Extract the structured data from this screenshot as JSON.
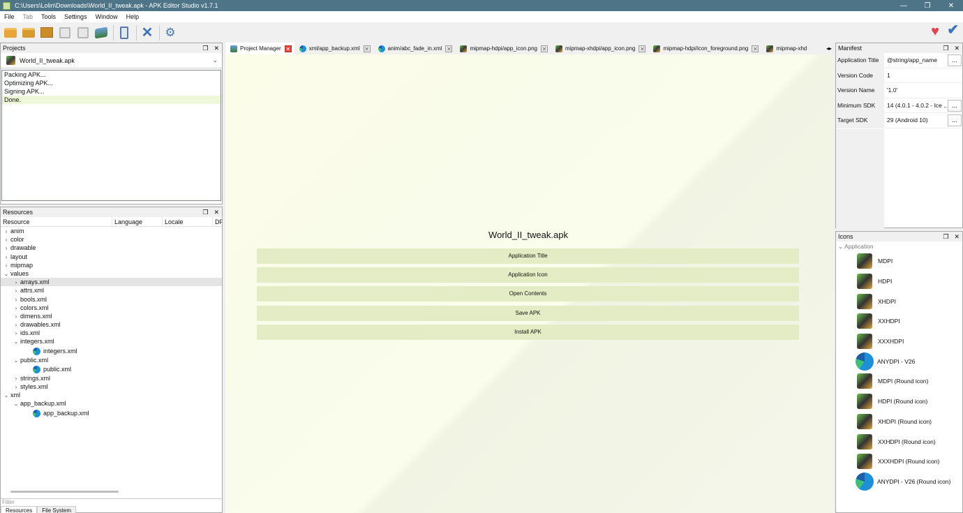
{
  "window": {
    "title": "C:\\Users\\Lolin\\Downloads\\World_II_tweak.apk - APK Editor Studio v1.7.1",
    "minimize": "—",
    "maximize": "❐",
    "close": "✕"
  },
  "menu": {
    "file": "File",
    "tab": "Tab",
    "tools": "Tools",
    "settings": "Settings",
    "window": "Window",
    "help": "Help"
  },
  "panel_controls": {
    "float": "❐",
    "close": "✕"
  },
  "projects": {
    "title": "Projects",
    "selected": "World_II_tweak.apk",
    "log": [
      "Packing APK...",
      "Optimizing APK...",
      "Signing APK...",
      "Done."
    ]
  },
  "resources": {
    "title": "Resources",
    "columns": [
      "Resource",
      "Language",
      "Locale",
      "DP"
    ],
    "tree": {
      "anim": "anim",
      "color": "color",
      "drawable": "drawable",
      "layout": "layout",
      "mipmap": "mipmap",
      "values": "values",
      "arrays": "arrays.xml",
      "attrs": "attrs.xml",
      "bools": "bools.xml",
      "colors": "colors.xml",
      "dimens": "dimens.xml",
      "drawables": "drawables.xml",
      "ids": "ids.xml",
      "integers": "integers.xml",
      "integers_child": "integers.xml",
      "public": "public.xml",
      "public_child": "public.xml",
      "strings": "strings.xml",
      "styles": "styles.xml",
      "xml": "xml",
      "app_backup": "app_backup.xml",
      "app_backup_child": "app_backup.xml"
    },
    "filter_placeholder": "Filter",
    "bottom_tabs": [
      "Resources",
      "File System"
    ]
  },
  "tabs": [
    {
      "label": "Project Manager"
    },
    {
      "label": "xml/app_backup.xml"
    },
    {
      "label": "anim/abc_fade_in.xml"
    },
    {
      "label": "mipmap-hdpi/app_icon.png"
    },
    {
      "label": "mipmap-xhdpi/app_icon.png"
    },
    {
      "label": "mipmap-hdpi/icon_foreground.png"
    },
    {
      "label": "mipmap-xhd"
    }
  ],
  "main": {
    "project_title": "World_II_tweak.apk",
    "actions": [
      "Application Title",
      "Application Icon",
      "Open Contents",
      "Save APK",
      "Install APK"
    ]
  },
  "manifest": {
    "title": "Manifest",
    "rows": [
      {
        "label": "Application Title",
        "value": "@string/app_name",
        "button": "..."
      },
      {
        "label": "Version Code",
        "value": "1"
      },
      {
        "label": "Version Name",
        "value": "'1.0'"
      },
      {
        "label": "Minimum SDK",
        "value": "14 (4.0.1 - 4.0.2 - Ice ...",
        "button": "..."
      },
      {
        "label": "Target SDK",
        "value": "29 (Android 10)",
        "button": "..."
      }
    ]
  },
  "icons": {
    "title": "Icons",
    "group": "Application",
    "items": [
      "MDPI",
      "HDPI",
      "XHDPI",
      "XXHDPI",
      "XXXHDPI",
      "ANYDPI - V26",
      "MDPI (Round icon)",
      "HDPI (Round icon)",
      "XHDPI (Round icon)",
      "XXHDPI (Round icon)",
      "XXXHDPI (Round icon)",
      "ANYDPI - V26 (Round icon)"
    ]
  },
  "colors": {
    "titlebar": "#4e7487",
    "accent_button": "#e4ecc6",
    "log_done_highlight": "#eef7d7"
  }
}
